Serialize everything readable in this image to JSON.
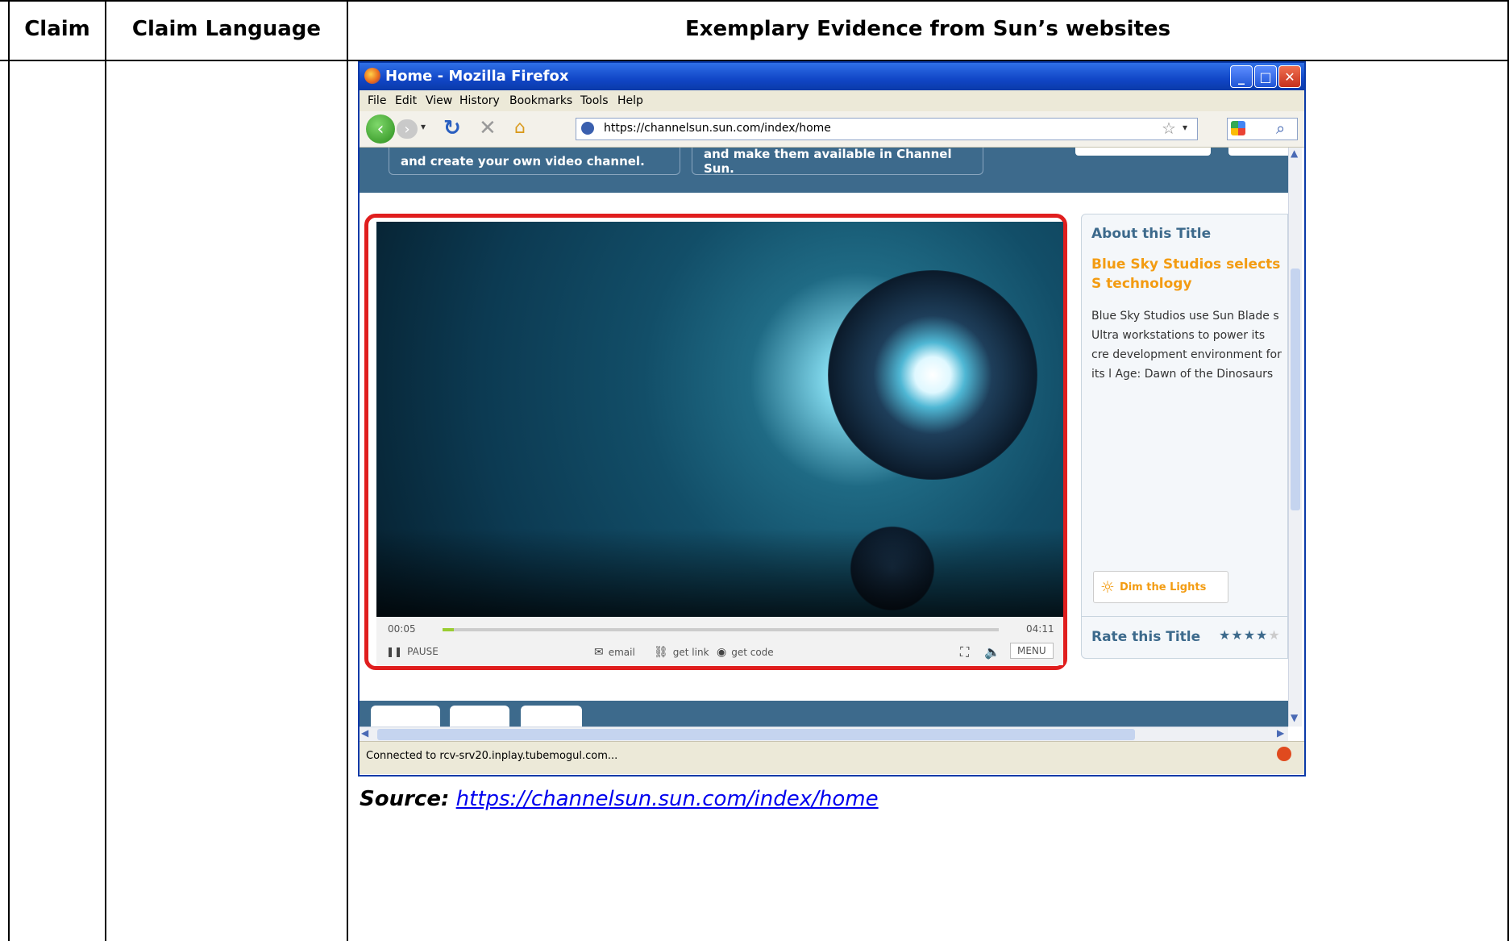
{
  "table": {
    "headers": [
      "Claim",
      "Claim Language",
      "Exemplary Evidence from Sun’s websites"
    ]
  },
  "browser": {
    "title": "Home - Mozilla Firefox",
    "menu": [
      "File",
      "Edit",
      "View",
      "History",
      "Bookmarks",
      "Tools",
      "Help"
    ],
    "url": "https://channelsun.sun.com/index/home",
    "status": "Connected to rcv-srv20.inplay.tubemogul.com..."
  },
  "page": {
    "banner_left": "and create your own video channel.",
    "banner_right": "and make them available in Channel Sun.",
    "player": {
      "time_current": "00:05",
      "time_total": "04:11",
      "progress": 0.02,
      "pause": "PAUSE",
      "email": "email",
      "get_link": "get link",
      "get_code": "get code",
      "menu": "MENU"
    },
    "about": {
      "heading": "About this Title",
      "title": "Blue Sky Studios selects S technology",
      "body": "Blue Sky Studios use Sun Blade s Ultra workstations to power its cre development environment for its l Age: Dawn of the Dinosaurs",
      "dim_button": "Dim the Lights",
      "rate_label": "Rate this Title",
      "rating": 4,
      "rating_max": 5
    }
  },
  "source": {
    "label": "Source:",
    "link": "https://channelsun.sun.com/index/home"
  },
  "colors": {
    "highlight": "#e01e1e",
    "accent_orange": "#f39c12",
    "banner": "#3d6a8c",
    "link": "#0000ee"
  }
}
